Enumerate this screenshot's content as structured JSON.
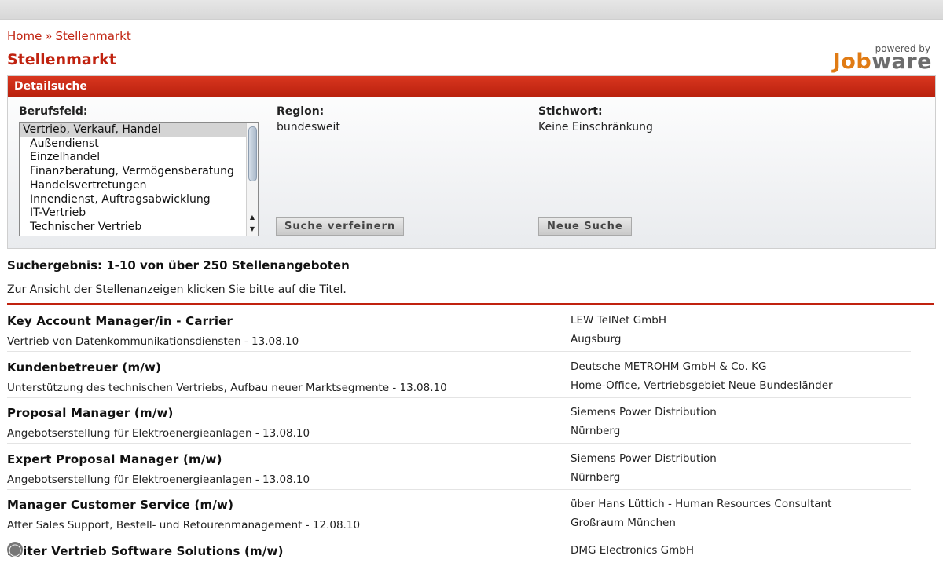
{
  "breadcrumb": {
    "home": "Home",
    "separator": "»",
    "current": "Stellenmarkt"
  },
  "page_title": "Stellenmarkt",
  "logo": {
    "powered_by": "powered by",
    "brand_part1": "Job",
    "brand_part2": "ware"
  },
  "search_panel": {
    "header": "Detailsuche",
    "berufsfeld_label": "Berufsfeld:",
    "berufsfeld_options": [
      "Vertrieb, Verkauf, Handel",
      "Außendienst",
      "Einzelhandel",
      "Finanzberatung, Vermögensberatung",
      "Handelsvertretungen",
      "Innendienst, Auftragsabwicklung",
      "IT-Vertrieb",
      "Technischer Vertrieb"
    ],
    "region_label": "Region:",
    "region_value": "bundesweit",
    "stichwort_label": "Stichwort:",
    "stichwort_value": "Keine Einschränkung",
    "refine_button": "Suche verfeinern",
    "new_search_button": "Neue Suche"
  },
  "results": {
    "count_text": "Suchergebnis: 1-10 von über 250 Stellenangeboten",
    "hint": "Zur Ansicht der Stellenanzeigen klicken Sie bitte auf die Titel.",
    "items": [
      {
        "title": "Key Account Manager/in - Carrier",
        "desc": "Vertrieb von Datenkommunikationsdiensten - 13.08.10",
        "company": "LEW TelNet GmbH",
        "location": "Augsburg"
      },
      {
        "title": "Kundenbetreuer (m/w)",
        "desc": "Unterstützung des technischen Vertriebs, Aufbau neuer Marktsegmente - 13.08.10",
        "company": "Deutsche METROHM GmbH & Co. KG",
        "location": "Home-Office, Vertriebsgebiet Neue Bundesländer"
      },
      {
        "title": "Proposal Manager (m/w)",
        "desc": "Angebotserstellung für Elektroenergieanlagen - 13.08.10",
        "company": "Siemens Power Distribution",
        "location": "Nürnberg"
      },
      {
        "title": "Expert Proposal Manager (m/w)",
        "desc": "Angebotserstellung für Elektroenergieanlagen - 13.08.10",
        "company": "Siemens Power Distribution",
        "location": "Nürnberg"
      },
      {
        "title": "Manager Customer Service (m/w)",
        "desc": "After Sales Support, Bestell- und Retourenmanagement - 12.08.10",
        "company": "über Hans Lüttich - Human Resources Consultant",
        "location": "Großraum München"
      },
      {
        "title": "Leiter Vertrieb Software Solutions (m/w)",
        "desc": "",
        "company": "DMG Electronics GmbH",
        "location": ""
      }
    ]
  }
}
